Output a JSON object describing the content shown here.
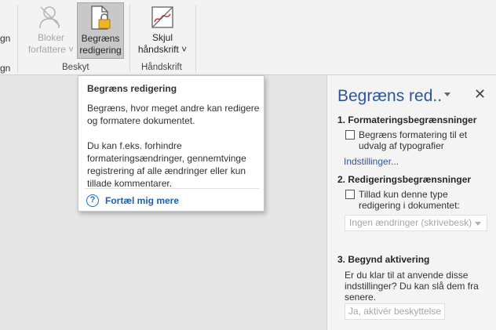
{
  "ribbon": {
    "cut_left_top": "gn",
    "cut_left_bottom": "gn",
    "block_authors": {
      "line1": "Bloker",
      "line2": "forfattere ˅"
    },
    "restrict_editing": {
      "line1": "Begræns",
      "line2": "redigering"
    },
    "hide_ink": {
      "line1": "Skjul",
      "line2": "håndskrift ˅"
    },
    "group_protect": "Beskyt",
    "group_ink": "Håndskrift"
  },
  "tooltip": {
    "title": "Begræns redigering",
    "para1": "Begræns, hvor meget andre kan redigere og formatere dokumentet.",
    "para2": "Du kan f.eks. forhindre formateringsændringer, gennemtvinge registrering af alle ændringer eller kun tillade kommentarer.",
    "more": "Fortæl mig mere"
  },
  "pane": {
    "title": "Begræns red..",
    "section1": "1. Formateringsbegrænsninger",
    "format_check": "Begræns formatering til et udvalg af typografier",
    "settings_link": "Indstillinger...",
    "section2": "2. Redigeringsbegrænsninger",
    "edit_check": "Tillad kun denne type redigering i dokumentet:",
    "edit_select": "Ingen ændringer (skrivebesk)",
    "section3": "3. Begynd aktivering",
    "desc": "Er du klar til at anvende disse indstillinger? Du kan slå dem fra senere.",
    "activate_button": "Ja, aktivér beskyttelse"
  }
}
